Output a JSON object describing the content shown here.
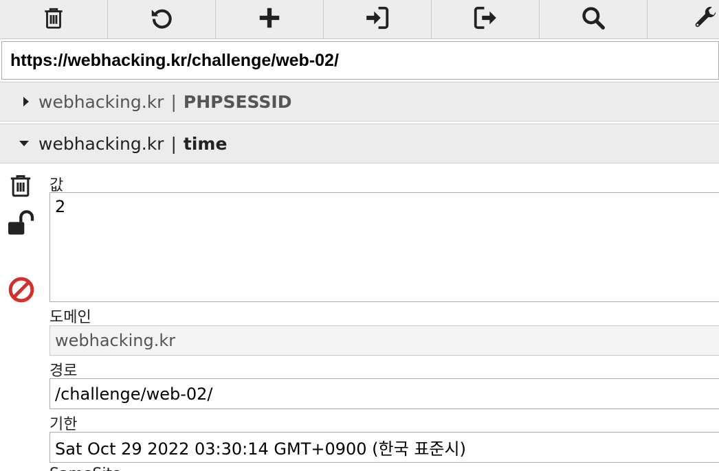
{
  "toolbar": {
    "buttons": [
      {
        "icon": "trash-icon"
      },
      {
        "icon": "refresh-icon"
      },
      {
        "icon": "plus-icon"
      },
      {
        "icon": "import-icon"
      },
      {
        "icon": "export-icon"
      },
      {
        "icon": "search-icon"
      },
      {
        "icon": "wrench-icon"
      }
    ]
  },
  "url": {
    "value": "https://webhacking.kr/challenge/web-02/"
  },
  "cookies": [
    {
      "domain": "webhacking.kr",
      "separator": "|",
      "name": "PHPSESSID",
      "expanded": false
    },
    {
      "domain": "webhacking.kr",
      "separator": "|",
      "name": "time",
      "expanded": true
    }
  ],
  "editor": {
    "value_label": "값",
    "value": "2",
    "domain_label": "도메인",
    "domain": "webhacking.kr",
    "path_label": "경로",
    "path": "/challenge/web-02/",
    "expires_label": "기한",
    "expires": "Sat Oct 29 2022 03:30:14 GMT+0900 (한국 표준시)",
    "next_label_partial": "SameSite"
  },
  "colors": {
    "toolbar_bg": "#ededed",
    "block_icon": "#d0312d"
  }
}
